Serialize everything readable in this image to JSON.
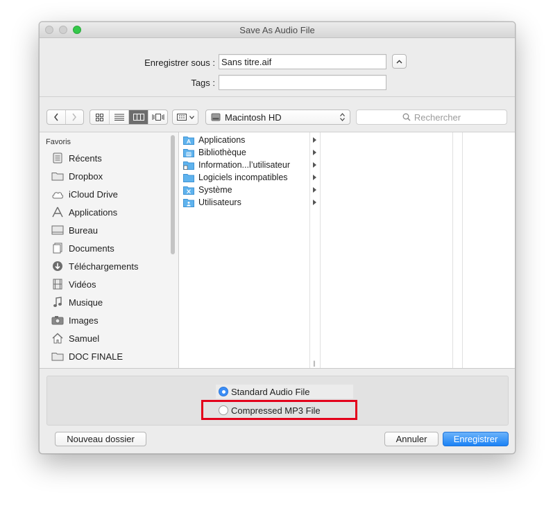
{
  "window": {
    "title": "Save As Audio File"
  },
  "save": {
    "save_as_label": "Enregistrer sous :",
    "filename": "Sans titre.aif",
    "tags_label": "Tags :",
    "tags_value": ""
  },
  "toolbar": {
    "location": "Macintosh HD",
    "search_placeholder": "Rechercher"
  },
  "sidebar": {
    "heading": "Favoris",
    "items": [
      {
        "label": "Récents",
        "icon": "recents-icon"
      },
      {
        "label": "Dropbox",
        "icon": "folder-icon"
      },
      {
        "label": "iCloud Drive",
        "icon": "cloud-icon"
      },
      {
        "label": "Applications",
        "icon": "applications-icon"
      },
      {
        "label": "Bureau",
        "icon": "desktop-icon"
      },
      {
        "label": "Documents",
        "icon": "documents-icon"
      },
      {
        "label": "Téléchargements",
        "icon": "download-icon"
      },
      {
        "label": "Vidéos",
        "icon": "film-icon"
      },
      {
        "label": "Musique",
        "icon": "music-icon"
      },
      {
        "label": "Images",
        "icon": "camera-icon"
      },
      {
        "label": "Samuel",
        "icon": "home-icon"
      },
      {
        "label": "DOC FINALE",
        "icon": "folder-icon"
      }
    ]
  },
  "column1": {
    "items": [
      {
        "label": "Applications"
      },
      {
        "label": "Bibliothèque"
      },
      {
        "label": "Information...l’utilisateur"
      },
      {
        "label": "Logiciels incompatibles"
      },
      {
        "label": "Système"
      },
      {
        "label": "Utilisateurs"
      }
    ]
  },
  "format": {
    "options": [
      {
        "label": "Standard Audio File",
        "selected": true
      },
      {
        "label": "Compressed MP3 File",
        "selected": false
      }
    ]
  },
  "buttons": {
    "new_folder": "Nouveau dossier",
    "cancel": "Annuler",
    "save": "Enregistrer"
  },
  "colors": {
    "accent": "#3b8df5",
    "highlight": "#e3001b",
    "folder": "#5fb3ee"
  }
}
